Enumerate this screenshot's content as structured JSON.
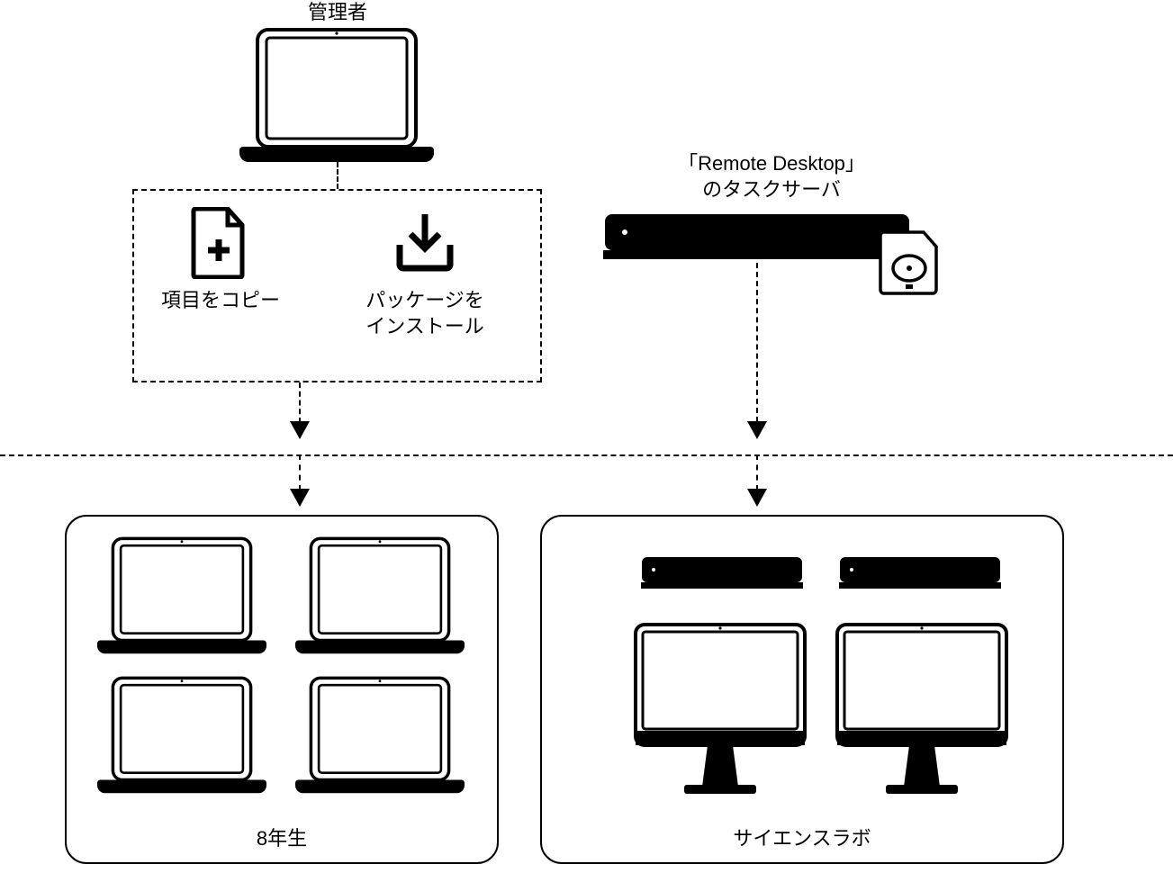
{
  "labels": {
    "admin": "管理者",
    "copy_items": "項目をコピー",
    "install_packages": "パッケージを\nインストール",
    "remote_desktop_server": "「Remote Desktop」\nのタスクサーバ",
    "grade8": "8年生",
    "science_lab": "サイエンスラボ"
  }
}
